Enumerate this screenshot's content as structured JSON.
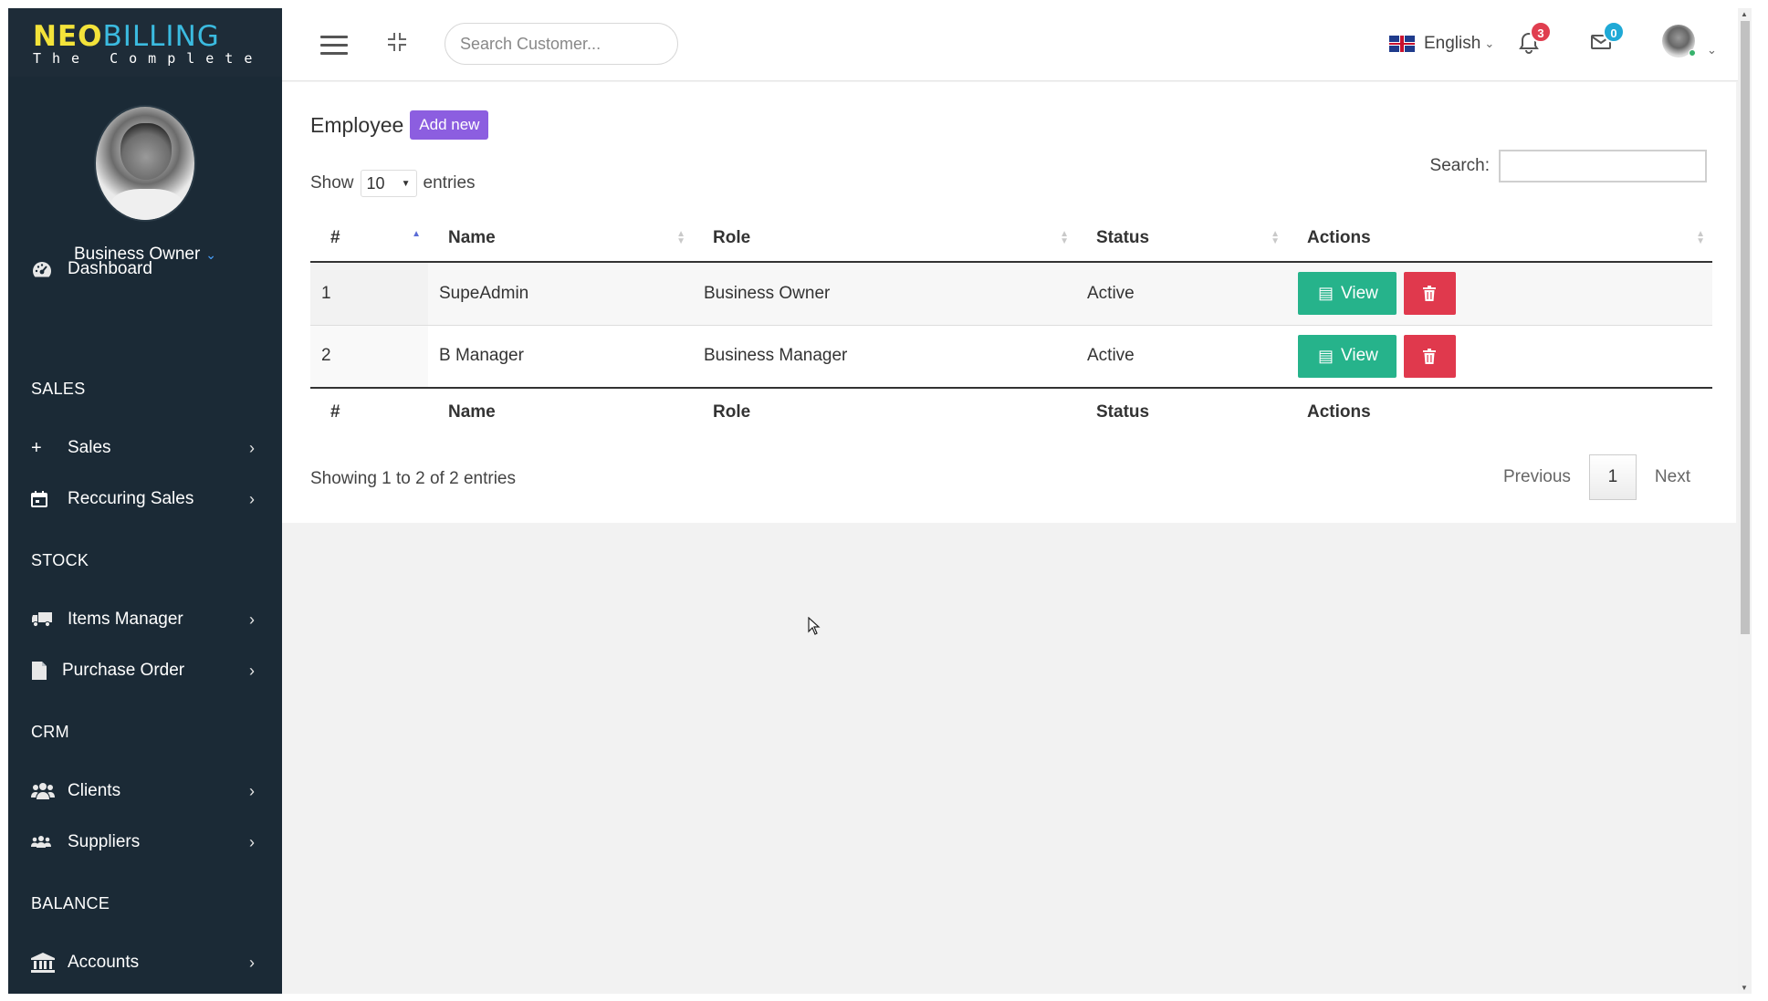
{
  "brand": {
    "logo_neo": "NEO",
    "logo_billing": "BILLING",
    "logo_sub": "The Complete"
  },
  "profile": {
    "role": "Business Owner"
  },
  "sidebar": {
    "dashboard": "Dashboard",
    "sections": [
      "SALES",
      "STOCK",
      "CRM",
      "BALANCE"
    ],
    "items": [
      {
        "label": "Sales"
      },
      {
        "label": "Reccuring Sales"
      },
      {
        "label": "Items Manager"
      },
      {
        "label": "Purchase Order"
      },
      {
        "label": "Clients"
      },
      {
        "label": "Suppliers"
      },
      {
        "label": "Accounts"
      }
    ]
  },
  "topbar": {
    "search_placeholder": "Search Customer...",
    "language": "English",
    "notifications_count": "3",
    "messages_count": "0"
  },
  "page": {
    "title": "Employee",
    "add_label": "Add new",
    "show_label": "Show",
    "entries_value": "10",
    "entries_label": "entries",
    "search_label": "Search:",
    "columns": [
      "#",
      "Name",
      "Role",
      "Status",
      "Actions"
    ],
    "rows": [
      {
        "num": "1",
        "name": "SupeAdmin",
        "role": "Business Owner",
        "status": "Active"
      },
      {
        "num": "2",
        "name": "B Manager",
        "role": "Business Manager",
        "status": "Active"
      }
    ],
    "view_label": "View",
    "info": "Showing 1 to 2 of 2 entries",
    "prev": "Previous",
    "current_page": "1",
    "next": "Next"
  },
  "colors": {
    "sidebar": "#1b2a36",
    "view": "#26b38b",
    "delete": "#e0394d",
    "add": "#8c5ee0"
  }
}
